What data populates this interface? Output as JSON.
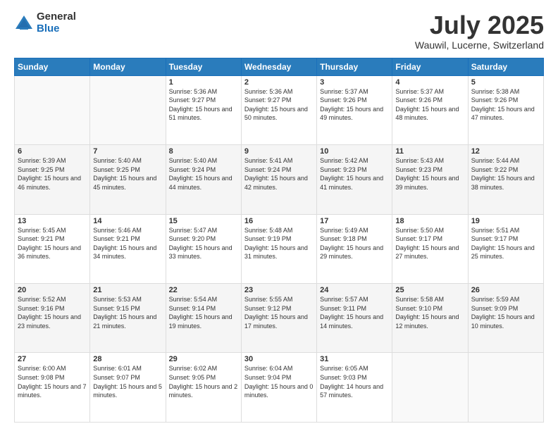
{
  "header": {
    "logo_general": "General",
    "logo_blue": "Blue",
    "title": "July 2025",
    "location": "Wauwil, Lucerne, Switzerland"
  },
  "days_of_week": [
    "Sunday",
    "Monday",
    "Tuesday",
    "Wednesday",
    "Thursday",
    "Friday",
    "Saturday"
  ],
  "weeks": [
    [
      {
        "day": "",
        "info": ""
      },
      {
        "day": "",
        "info": ""
      },
      {
        "day": "1",
        "sunrise": "5:36 AM",
        "sunset": "9:27 PM",
        "daylight": "15 hours and 51 minutes."
      },
      {
        "day": "2",
        "sunrise": "5:36 AM",
        "sunset": "9:27 PM",
        "daylight": "15 hours and 50 minutes."
      },
      {
        "day": "3",
        "sunrise": "5:37 AM",
        "sunset": "9:26 PM",
        "daylight": "15 hours and 49 minutes."
      },
      {
        "day": "4",
        "sunrise": "5:37 AM",
        "sunset": "9:26 PM",
        "daylight": "15 hours and 48 minutes."
      },
      {
        "day": "5",
        "sunrise": "5:38 AM",
        "sunset": "9:26 PM",
        "daylight": "15 hours and 47 minutes."
      }
    ],
    [
      {
        "day": "6",
        "sunrise": "5:39 AM",
        "sunset": "9:25 PM",
        "daylight": "15 hours and 46 minutes."
      },
      {
        "day": "7",
        "sunrise": "5:40 AM",
        "sunset": "9:25 PM",
        "daylight": "15 hours and 45 minutes."
      },
      {
        "day": "8",
        "sunrise": "5:40 AM",
        "sunset": "9:24 PM",
        "daylight": "15 hours and 44 minutes."
      },
      {
        "day": "9",
        "sunrise": "5:41 AM",
        "sunset": "9:24 PM",
        "daylight": "15 hours and 42 minutes."
      },
      {
        "day": "10",
        "sunrise": "5:42 AM",
        "sunset": "9:23 PM",
        "daylight": "15 hours and 41 minutes."
      },
      {
        "day": "11",
        "sunrise": "5:43 AM",
        "sunset": "9:23 PM",
        "daylight": "15 hours and 39 minutes."
      },
      {
        "day": "12",
        "sunrise": "5:44 AM",
        "sunset": "9:22 PM",
        "daylight": "15 hours and 38 minutes."
      }
    ],
    [
      {
        "day": "13",
        "sunrise": "5:45 AM",
        "sunset": "9:21 PM",
        "daylight": "15 hours and 36 minutes."
      },
      {
        "day": "14",
        "sunrise": "5:46 AM",
        "sunset": "9:21 PM",
        "daylight": "15 hours and 34 minutes."
      },
      {
        "day": "15",
        "sunrise": "5:47 AM",
        "sunset": "9:20 PM",
        "daylight": "15 hours and 33 minutes."
      },
      {
        "day": "16",
        "sunrise": "5:48 AM",
        "sunset": "9:19 PM",
        "daylight": "15 hours and 31 minutes."
      },
      {
        "day": "17",
        "sunrise": "5:49 AM",
        "sunset": "9:18 PM",
        "daylight": "15 hours and 29 minutes."
      },
      {
        "day": "18",
        "sunrise": "5:50 AM",
        "sunset": "9:17 PM",
        "daylight": "15 hours and 27 minutes."
      },
      {
        "day": "19",
        "sunrise": "5:51 AM",
        "sunset": "9:17 PM",
        "daylight": "15 hours and 25 minutes."
      }
    ],
    [
      {
        "day": "20",
        "sunrise": "5:52 AM",
        "sunset": "9:16 PM",
        "daylight": "15 hours and 23 minutes."
      },
      {
        "day": "21",
        "sunrise": "5:53 AM",
        "sunset": "9:15 PM",
        "daylight": "15 hours and 21 minutes."
      },
      {
        "day": "22",
        "sunrise": "5:54 AM",
        "sunset": "9:14 PM",
        "daylight": "15 hours and 19 minutes."
      },
      {
        "day": "23",
        "sunrise": "5:55 AM",
        "sunset": "9:12 PM",
        "daylight": "15 hours and 17 minutes."
      },
      {
        "day": "24",
        "sunrise": "5:57 AM",
        "sunset": "9:11 PM",
        "daylight": "15 hours and 14 minutes."
      },
      {
        "day": "25",
        "sunrise": "5:58 AM",
        "sunset": "9:10 PM",
        "daylight": "15 hours and 12 minutes."
      },
      {
        "day": "26",
        "sunrise": "5:59 AM",
        "sunset": "9:09 PM",
        "daylight": "15 hours and 10 minutes."
      }
    ],
    [
      {
        "day": "27",
        "sunrise": "6:00 AM",
        "sunset": "9:08 PM",
        "daylight": "15 hours and 7 minutes."
      },
      {
        "day": "28",
        "sunrise": "6:01 AM",
        "sunset": "9:07 PM",
        "daylight": "15 hours and 5 minutes."
      },
      {
        "day": "29",
        "sunrise": "6:02 AM",
        "sunset": "9:05 PM",
        "daylight": "15 hours and 2 minutes."
      },
      {
        "day": "30",
        "sunrise": "6:04 AM",
        "sunset": "9:04 PM",
        "daylight": "15 hours and 0 minutes."
      },
      {
        "day": "31",
        "sunrise": "6:05 AM",
        "sunset": "9:03 PM",
        "daylight": "14 hours and 57 minutes."
      },
      {
        "day": "",
        "info": ""
      },
      {
        "day": "",
        "info": ""
      }
    ]
  ],
  "labels": {
    "sunrise_prefix": "Sunrise: ",
    "sunset_prefix": "Sunset: ",
    "daylight_prefix": "Daylight: "
  }
}
